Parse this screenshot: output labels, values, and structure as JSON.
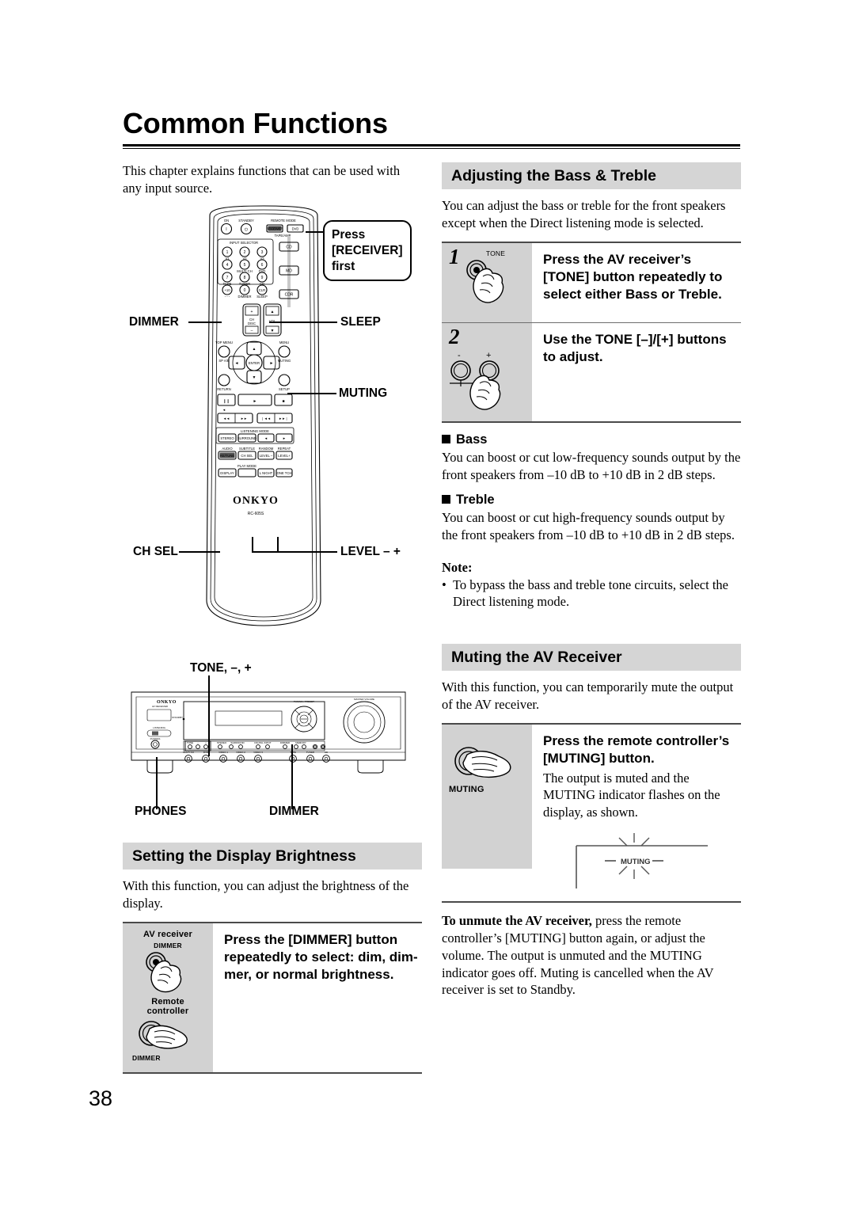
{
  "page": {
    "title": "Common Functions",
    "number": "38",
    "intro": "This chapter explains functions that can be used with any input source."
  },
  "remote_callout": {
    "line1": "Press",
    "line2": "[RECEIVER]",
    "line3": "first"
  },
  "remote_labels": {
    "dimmer": "DIMMER",
    "sleep": "SLEEP",
    "muting": "MUTING",
    "ch_sel": "CH SEL",
    "level": "LEVEL – +"
  },
  "remote_art": {
    "on": "ON",
    "standby": "STANDBY",
    "remote_mode": "REMOTE MODE",
    "mode_receiver": "RECEIVER",
    "mode_dvd": "DVD",
    "tape_amp": "TAPE/AMP",
    "input_selector": "INPUT SELECTOR",
    "side_buttons": [
      "CD",
      "MD",
      "CDR"
    ],
    "keypad": [
      {
        "num": "1",
        "sub": "V1"
      },
      {
        "num": "2",
        "sub": "V2"
      },
      {
        "num": "3",
        "sub": "V3"
      },
      {
        "num": "4",
        "sub": ""
      },
      {
        "num": "5",
        "sub": "MULTI CH"
      },
      {
        "num": "6",
        "sub": "DVD"
      },
      {
        "num": "7",
        "sub": "TAPE"
      },
      {
        "num": "8",
        "sub": "TUNER"
      },
      {
        "num": "9",
        "sub": "CD"
      },
      {
        "num": "+10",
        "sub": ""
      },
      {
        "num": "0",
        "sub": "DIMMER"
      },
      {
        "num": "CLR",
        "sub": "SLEEP"
      }
    ],
    "ch_disc": "CH\nDISC",
    "vol": "VOL",
    "top_menu": "TOP MENU",
    "sp_ab": "SP A/B",
    "menu": "MENU",
    "muting": "MUTING",
    "enter": "ENTER",
    "return": "RETURN",
    "setup": "SETUP",
    "listening_mode": "LISTENING MODE",
    "lm_buttons": [
      "STEREO",
      "SURROUND"
    ],
    "row_labels": [
      "AUDIO",
      "SUBTITLE",
      "RANDOM",
      "REPEAT"
    ],
    "row_buttons": [
      "RE/TUNE",
      "CH SEL",
      "LEVEL –",
      "LEVEL +"
    ],
    "play_mode": "PLAY MODE",
    "bottom_buttons": [
      "DISPLAY",
      "",
      "L NIGHT",
      "ONE TCH"
    ],
    "brand": "ONKYO",
    "model": "RC-605S"
  },
  "receiver_labels": {
    "tone": "TONE, –, +",
    "phones": "PHONES",
    "dimmer": "DIMMER",
    "brand": "ONKYO"
  },
  "display_brightness": {
    "header": "Setting the Display Brightness",
    "intro": "With this function, you can adjust the brightness of the display.",
    "icon_av_receiver": "AV receiver",
    "icon_dimmer_1": "DIMMER",
    "icon_remote_1": "Remote",
    "icon_remote_2": "controller",
    "icon_dimmer_2": "DIMMER",
    "instruction": "Press the [DIMMER] button repeatedly to select: dim, dim-mer, or normal brightness."
  },
  "bass_treble": {
    "header": "Adjusting the Bass & Treble",
    "intro": "You can adjust the bass or treble for the front speakers except when the Direct listening mode is selected.",
    "steps": [
      {
        "num": "1",
        "icon_label": "TONE",
        "text": "Press the AV receiver’s [TONE] button repeatedly to select either Bass or Treble."
      },
      {
        "num": "2",
        "icon_minus": "-",
        "icon_plus": "+",
        "text": "Use the TONE [–]/[+] buttons to adjust."
      }
    ],
    "bass_head": "Bass",
    "bass_text": "You can boost or cut low-frequency sounds output by the front speakers from –10 dB to +10 dB in 2 dB steps.",
    "treble_head": "Treble",
    "treble_text": "You can boost or cut high-frequency sounds output by the front speakers from –10 dB to +10 dB in 2 dB steps.",
    "note_head": "Note:",
    "note_bullet": "•",
    "note_text": "To bypass the bass and treble tone circuits, select the Direct listening mode."
  },
  "muting": {
    "header": "Muting the AV Receiver",
    "intro": "With this function, you can temporarily mute the output of the AV receiver.",
    "icon_label": "MUTING",
    "instruction_bold": "Press the remote controller’s [MUTING] button.",
    "instruction_body": "The output is muted and the MUTING indicator flashes on the display, as shown.",
    "display_indicator": "MUTING",
    "unmute_bold": "To unmute the AV receiver,",
    "unmute_rest": " press the remote controller’s [MUTING] button again, or adjust the volume. The output is unmuted and the MUTING indicator goes off. Muting is cancelled when the AV receiver is set to Standby."
  },
  "colors": {
    "header_bar": "#d5d5d5",
    "step_icon_bg": "#d2d2d2",
    "rule": "#4a4a4a"
  }
}
